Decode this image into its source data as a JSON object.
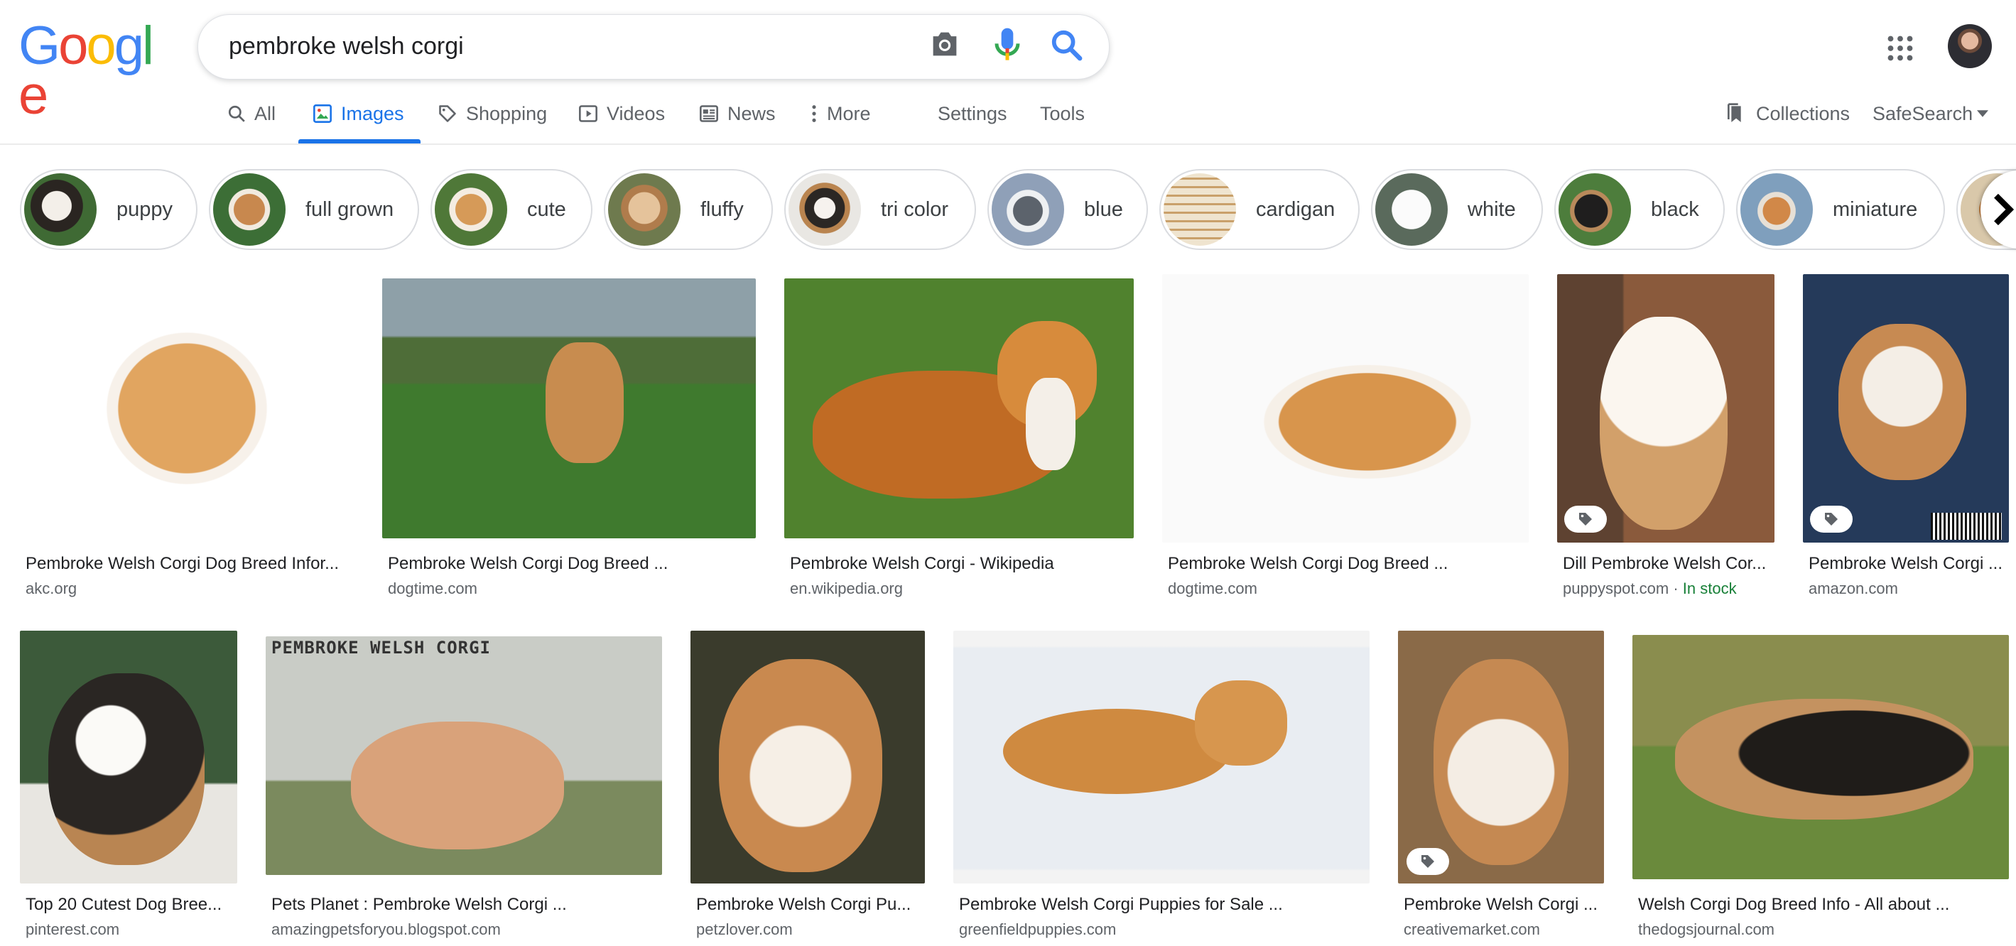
{
  "header": {
    "logo_text": "Google",
    "search_value": "pembroke welsh corgi",
    "icons": {
      "camera": "camera-icon",
      "mic": "mic-icon",
      "search": "search-icon",
      "apps": "apps-grid-icon"
    }
  },
  "tabs": [
    {
      "label": "All",
      "icon": "search-icon"
    },
    {
      "label": "Images",
      "icon": "image-icon",
      "active": true
    },
    {
      "label": "Shopping",
      "icon": "tag-icon"
    },
    {
      "label": "Videos",
      "icon": "play-icon"
    },
    {
      "label": "News",
      "icon": "news-icon"
    },
    {
      "label": "More",
      "icon": "dots-vertical-icon"
    },
    {
      "label": "Settings"
    },
    {
      "label": "Tools"
    }
  ],
  "right_tools": {
    "collections": "Collections",
    "safesearch": "SafeSearch"
  },
  "chips": [
    "puppy",
    "full grown",
    "cute",
    "fluffy",
    "tri color",
    "blue",
    "cardigan",
    "white",
    "black",
    "miniature"
  ],
  "results_row1": [
    {
      "title": "Pembroke Welsh Corgi Dog Breed Infor...",
      "source": "akc.org"
    },
    {
      "title": "Pembroke Welsh Corgi Dog Breed ...",
      "source": "dogtime.com"
    },
    {
      "title": "Pembroke Welsh Corgi - Wikipedia",
      "source": "en.wikipedia.org"
    },
    {
      "title": "Pembroke Welsh Corgi Dog Breed ...",
      "source": "dogtime.com"
    },
    {
      "title": "Dill Pembroke Welsh Cor...",
      "source": "puppyspot.com",
      "stock": "In stock",
      "sep": " · "
    },
    {
      "title": "Pembroke Welsh Corgi ...",
      "source": "amazon.com"
    }
  ],
  "results_row2": [
    {
      "title": "Top 20 Cutest Dog Bree...",
      "source": "pinterest.com"
    },
    {
      "title": "Pets Planet : Pembroke Welsh Corgi ...",
      "source": "amazingpetsforyou.blogspot.com",
      "overlay": "PEMBROKE WELSH CORGI"
    },
    {
      "title": "Pembroke Welsh Corgi Pu...",
      "source": "petzlover.com"
    },
    {
      "title": "Pembroke Welsh Corgi Puppies for Sale ...",
      "source": "greenfieldpuppies.com"
    },
    {
      "title": "Pembroke Welsh Corgi ...",
      "source": "creativemarket.com"
    },
    {
      "title": "Welsh Corgi Dog Breed Info - All about ...",
      "source": "thedogsjournal.com"
    }
  ],
  "colors": {
    "accent": "#1a73e8",
    "in_stock": "#188038"
  }
}
